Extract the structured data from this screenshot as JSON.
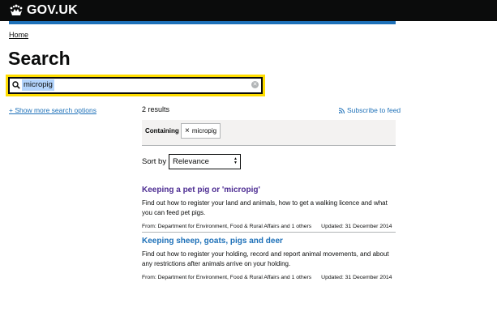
{
  "header": {
    "logo_text": "GOV.UK"
  },
  "breadcrumb": {
    "home": "Home"
  },
  "page": {
    "title": "Search"
  },
  "search": {
    "query": "micropig"
  },
  "sidebar": {
    "more_options": "+ Show more search options"
  },
  "results_header": {
    "count": "2 results",
    "subscribe": "Subscribe to feed"
  },
  "filters": {
    "label": "Containing",
    "tag": "micropig",
    "tag_remove_icon": "close-icon"
  },
  "sort": {
    "label": "Sort by",
    "selected": "Relevance"
  },
  "results": [
    {
      "title": "Keeping a pet pig or 'micropig'",
      "description": "Find out how to register your land and animals, how to get a walking licence and what you can feed pet pigs.",
      "from": "From: Department for Environment, Food & Rural Affairs and 1 others",
      "updated": "Updated: 31 December 2014",
      "visited": true
    },
    {
      "title": "Keeping sheep, goats, pigs and deer",
      "description": "Find out how to register your holding, record and report animal movements, and about any restrictions after animals arrive on your holding.",
      "from": "From: Department for Environment, Food & Rural Affairs and 1 others",
      "updated": "Updated: 31 December 2014",
      "visited": false
    }
  ],
  "colors": {
    "link": "#1d70b8",
    "visited": "#4c2c92",
    "focus": "#ffdd00",
    "header": "#0b0c0c"
  }
}
